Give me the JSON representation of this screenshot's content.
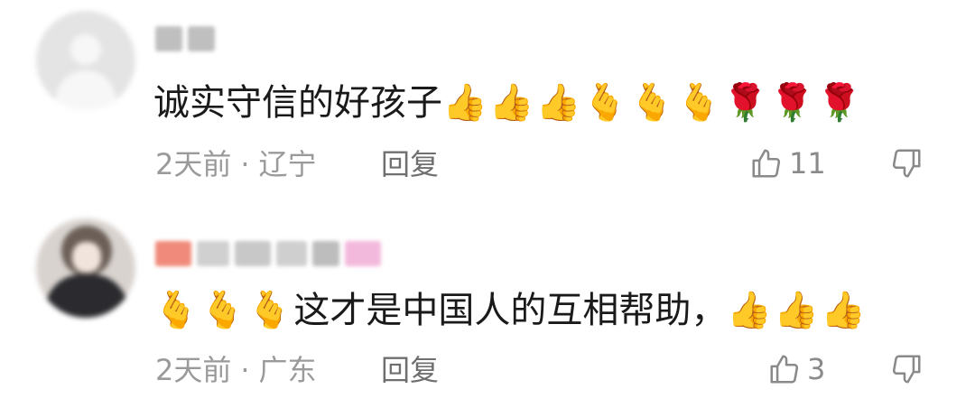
{
  "comments": [
    {
      "text": "诚实守信的好孩子",
      "emojis_after": "👍👍👍🫰🫰🫰🌹🌹🌹",
      "time": "2天前",
      "separator": "·",
      "location": "辽宁",
      "reply_label": "回复",
      "like_count": "11"
    },
    {
      "emojis_before": "🫰🫰🫰",
      "text": "这才是中国人的互相帮助，",
      "emojis_after": "👍👍👍",
      "time": "2天前",
      "separator": "·",
      "location": "广东",
      "reply_label": "回复",
      "like_count": "3"
    }
  ],
  "icons": {
    "like": "thumbs-up-outline-icon",
    "dislike": "thumbs-down-outline-icon"
  },
  "colors": {
    "text_primary": "#1a1a1a",
    "text_secondary": "#9a9a9a",
    "icon": "#8a8a8a"
  }
}
